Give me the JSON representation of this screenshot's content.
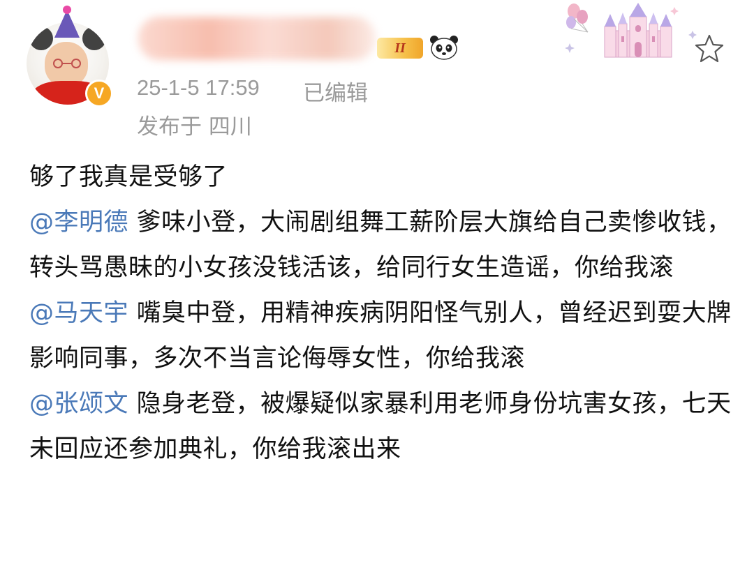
{
  "header": {
    "verified_badge": "V",
    "level_badge": "II",
    "time": "25-1-5 17:59",
    "edited": "已编辑",
    "location": "发布于 四川"
  },
  "post": {
    "line1": "够了我真是受够了",
    "mention1": {
      "name": "@李明德",
      "text": "爹味小登，大闹剧组舞工薪阶层大旗给自己卖惨收钱，转头骂愚昧的小女孩没钱活该，给同行女生造谣，你给我滚"
    },
    "mention2": {
      "name": "@马天宇",
      "text": "嘴臭中登，用精神疾病阴阳怪气别人，曾经迟到耍大牌影响同事，多次不当言论侮辱女性，你给我滚"
    },
    "mention3": {
      "name": "@张颂文",
      "text": "隐身老登，被爆疑似家暴利用老师身份坑害女孩，七天未回应还参加典礼，你给我滚出来"
    }
  },
  "colors": {
    "mention": "#4a79b8",
    "meta": "#9a9a9a",
    "verified": "#f6a724"
  },
  "icons": [
    "verified-icon",
    "panda-icon",
    "castle-decoration",
    "star-icon",
    "party-hat"
  ]
}
